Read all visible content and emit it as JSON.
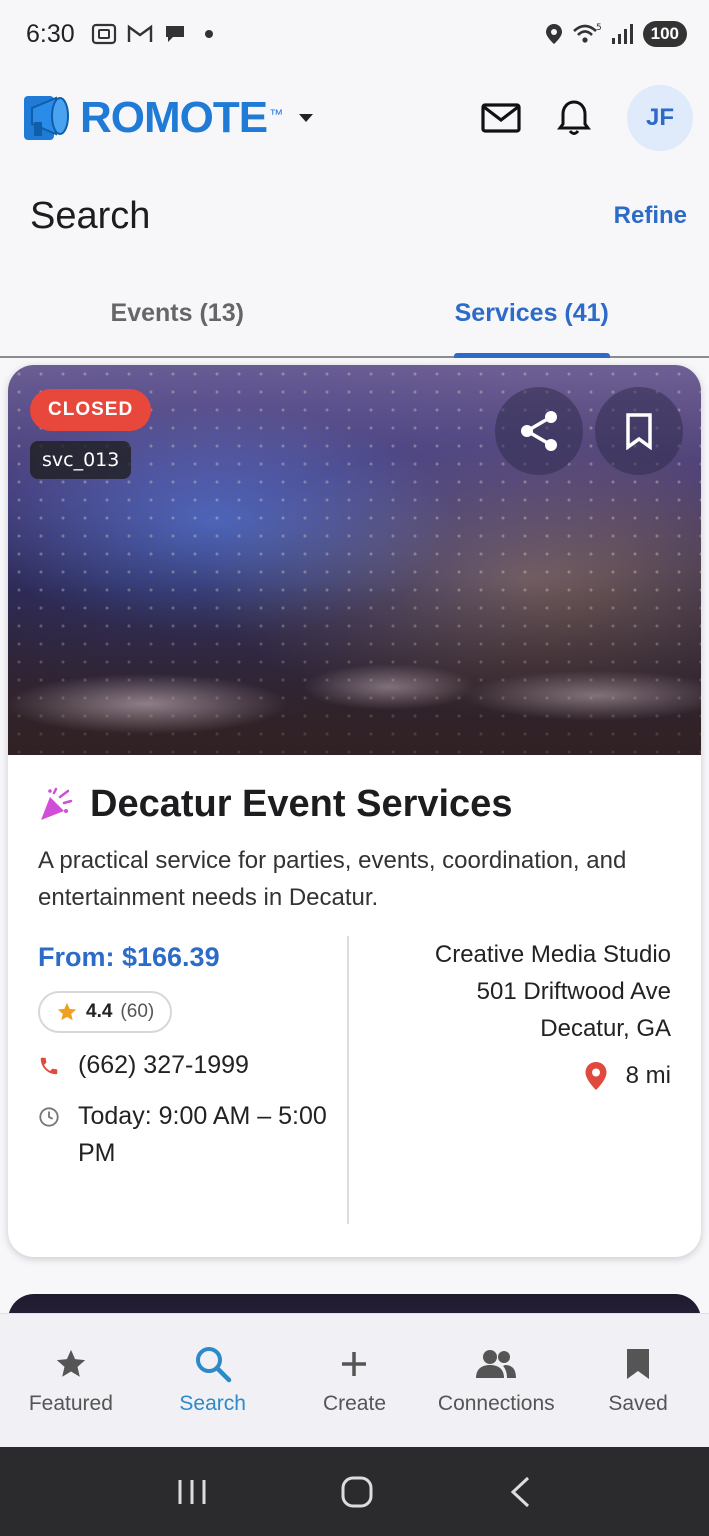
{
  "status_bar": {
    "time": "6:30",
    "battery": "100"
  },
  "header": {
    "logo_text": "ROMOTE",
    "logo_tm": "™",
    "avatar_initials": "JF"
  },
  "search": {
    "title": "Search",
    "refine_label": "Refine"
  },
  "tabs": [
    {
      "label": "Events (13)",
      "active": false
    },
    {
      "label": "Services (41)",
      "active": true
    }
  ],
  "card": {
    "status_badge": "CLOSED",
    "service_id": "svc_013",
    "title": "Decatur Event Services",
    "description": "A practical service for parties, events, coordination, and entertainment needs in Decatur.",
    "price": "From: $166.39",
    "rating": "4.4",
    "rating_count": "(60)",
    "phone": "(662) 327-1999",
    "hours": "Today: 9:00 AM – 5:00 PM",
    "provider": "Creative Media Studio",
    "address_line1": "501 Driftwood Ave",
    "address_line2": "Decatur, GA",
    "distance": "8 mi"
  },
  "bottom_nav": [
    {
      "label": "Featured",
      "icon": "star-icon",
      "active": false
    },
    {
      "label": "Search",
      "icon": "search-icon",
      "active": true
    },
    {
      "label": "Create",
      "icon": "plus-icon",
      "active": false
    },
    {
      "label": "Connections",
      "icon": "people-icon",
      "active": false
    },
    {
      "label": "Saved",
      "icon": "bookmark-icon",
      "active": false
    }
  ],
  "colors": {
    "accent": "#2c6bc7",
    "closed_badge": "#e8473c",
    "star": "#f0a020"
  }
}
